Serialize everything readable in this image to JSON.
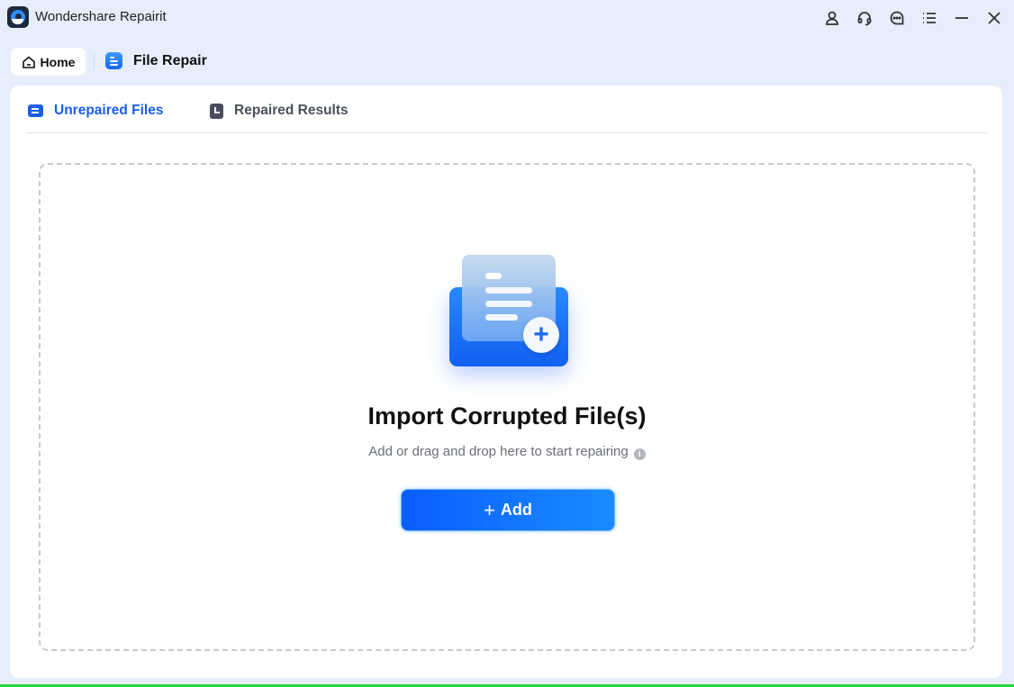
{
  "app": {
    "title": "Wondershare Repairit"
  },
  "window_controls": [
    {
      "name": "account-icon"
    },
    {
      "name": "support-headset-icon"
    },
    {
      "name": "feedback-chat-icon"
    },
    {
      "name": "menu-list-icon"
    },
    {
      "name": "minimize-icon"
    },
    {
      "name": "close-icon"
    }
  ],
  "nav": {
    "home_label": "Home",
    "current_label": "File Repair"
  },
  "tabs": [
    {
      "label": "Unrepaired Files",
      "active": true
    },
    {
      "label": "Repaired Results",
      "active": false
    }
  ],
  "dropzone": {
    "title": "Import Corrupted File(s)",
    "subtitle": "Add or drag and drop here to start repairing",
    "info_glyph": "i",
    "add_button_label": "Add",
    "add_button_glyph": "+"
  },
  "colors": {
    "accent": "#1a5ee6",
    "button_start": "#0a5dff",
    "button_end": "#1a8cff",
    "background": "#e6eefc"
  }
}
